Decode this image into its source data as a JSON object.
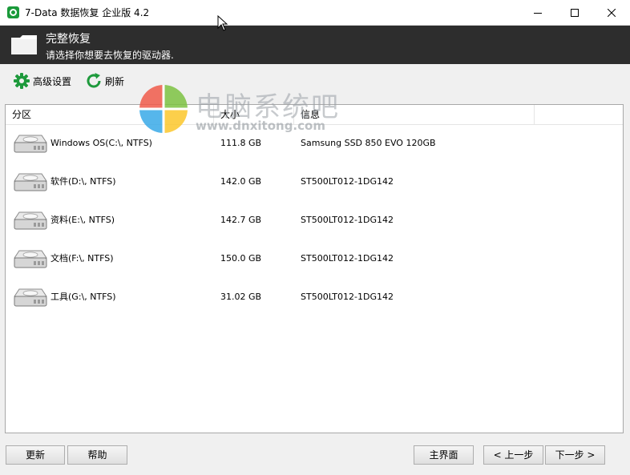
{
  "window": {
    "title": "7-Data 数据恢复 企业版 4.2"
  },
  "header": {
    "title": "完整恢复",
    "subtitle": "请选择你想要去恢复的驱动器."
  },
  "toolbar": {
    "advanced_label": "高级设置",
    "refresh_label": "刷新"
  },
  "watermark": {
    "text": "电脑系统吧",
    "url": "www.dnxitong.com"
  },
  "table": {
    "columns": [
      "分区",
      "大小",
      "信息"
    ],
    "rows": [
      {
        "partition": "Windows OS(C:\\, NTFS)",
        "size": "111.8 GB",
        "info": "Samsung SSD 850 EVO 120GB"
      },
      {
        "partition": "软件(D:\\, NTFS)",
        "size": "142.0 GB",
        "info": "ST500LT012-1DG142"
      },
      {
        "partition": "资料(E:\\, NTFS)",
        "size": "142.7 GB",
        "info": "ST500LT012-1DG142"
      },
      {
        "partition": "文档(F:\\, NTFS)",
        "size": "150.0 GB",
        "info": "ST500LT012-1DG142"
      },
      {
        "partition": "工具(G:\\, NTFS)",
        "size": "31.02 GB",
        "info": "ST500LT012-1DG142"
      }
    ]
  },
  "footer": {
    "update_label": "更新",
    "help_label": "帮助",
    "home_label": "主界面",
    "prev_label": "< 上一步",
    "next_label": "下一步 >"
  },
  "colors": {
    "header_bg": "#2d2d2d",
    "app_icon": "#1a9a3a",
    "toolbar_icon": "#1e9a3c"
  },
  "icons": {
    "app": "app-logo-icon",
    "header": "folder-icon",
    "advanced": "gear-icon",
    "refresh": "refresh-icon",
    "drive": "hard-drive-icon"
  }
}
